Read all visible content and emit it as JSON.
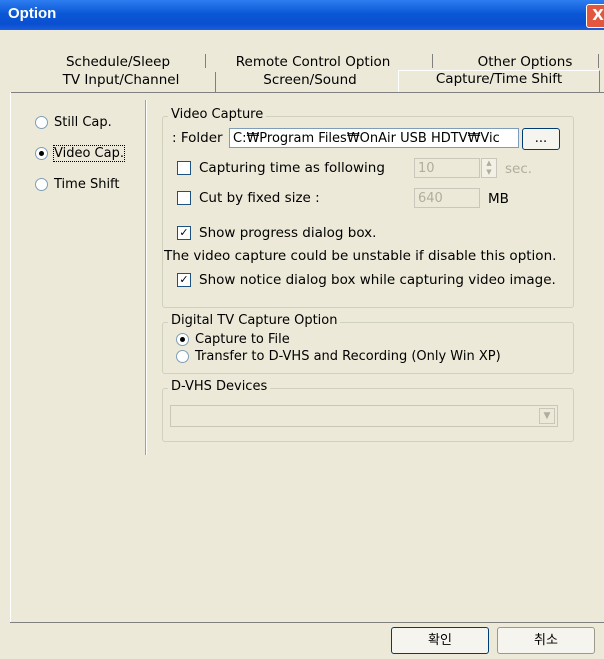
{
  "window": {
    "title": "Option",
    "close_glyph": "X"
  },
  "tabs": {
    "row1": [
      {
        "label": "Schedule/Sleep"
      },
      {
        "label": "Remote Control Option"
      },
      {
        "label": "Other Options"
      }
    ],
    "row2": [
      {
        "label": "TV Input/Channel"
      },
      {
        "label": "Screen/Sound"
      },
      {
        "label": "Capture/Time Shift",
        "selected": true
      }
    ]
  },
  "mode": {
    "options": [
      {
        "label": "Still Cap.",
        "selected": false
      },
      {
        "label": "Video Cap.",
        "selected": true
      },
      {
        "label": "Time Shift",
        "selected": false
      }
    ]
  },
  "video_capture": {
    "title": "Video Capture",
    "folder_label": ": Folder",
    "folder_value": "C:₩Program Files₩OnAir USB HDTV₩Vic",
    "browse_label": "...",
    "capturing_time": {
      "label": "Capturing time as following",
      "checked": false,
      "value": "10",
      "unit": "sec."
    },
    "cut_size": {
      "label": "Cut by fixed size :",
      "checked": false,
      "value": "640",
      "unit": "MB"
    },
    "show_progress": {
      "label": "Show progress dialog box.",
      "checked": true
    },
    "warning_text": "The video capture could be unstable if disable this option.",
    "show_notice": {
      "label": "Show notice dialog box while capturing video image.",
      "checked": true
    }
  },
  "digital_tv": {
    "title": "Digital TV Capture Option",
    "options": [
      {
        "label": "Capture to File",
        "selected": true
      },
      {
        "label": "Transfer to D-VHS and Recording (Only Win XP)",
        "selected": false
      }
    ]
  },
  "dvhs": {
    "title": "D-VHS Devices",
    "value": ""
  },
  "footer": {
    "ok_label": "확인",
    "cancel_label": "취소"
  },
  "colors": {
    "titlebar": "#0a58d6",
    "dialog_bg": "#ece9d8",
    "close_button": "#e2583e"
  }
}
